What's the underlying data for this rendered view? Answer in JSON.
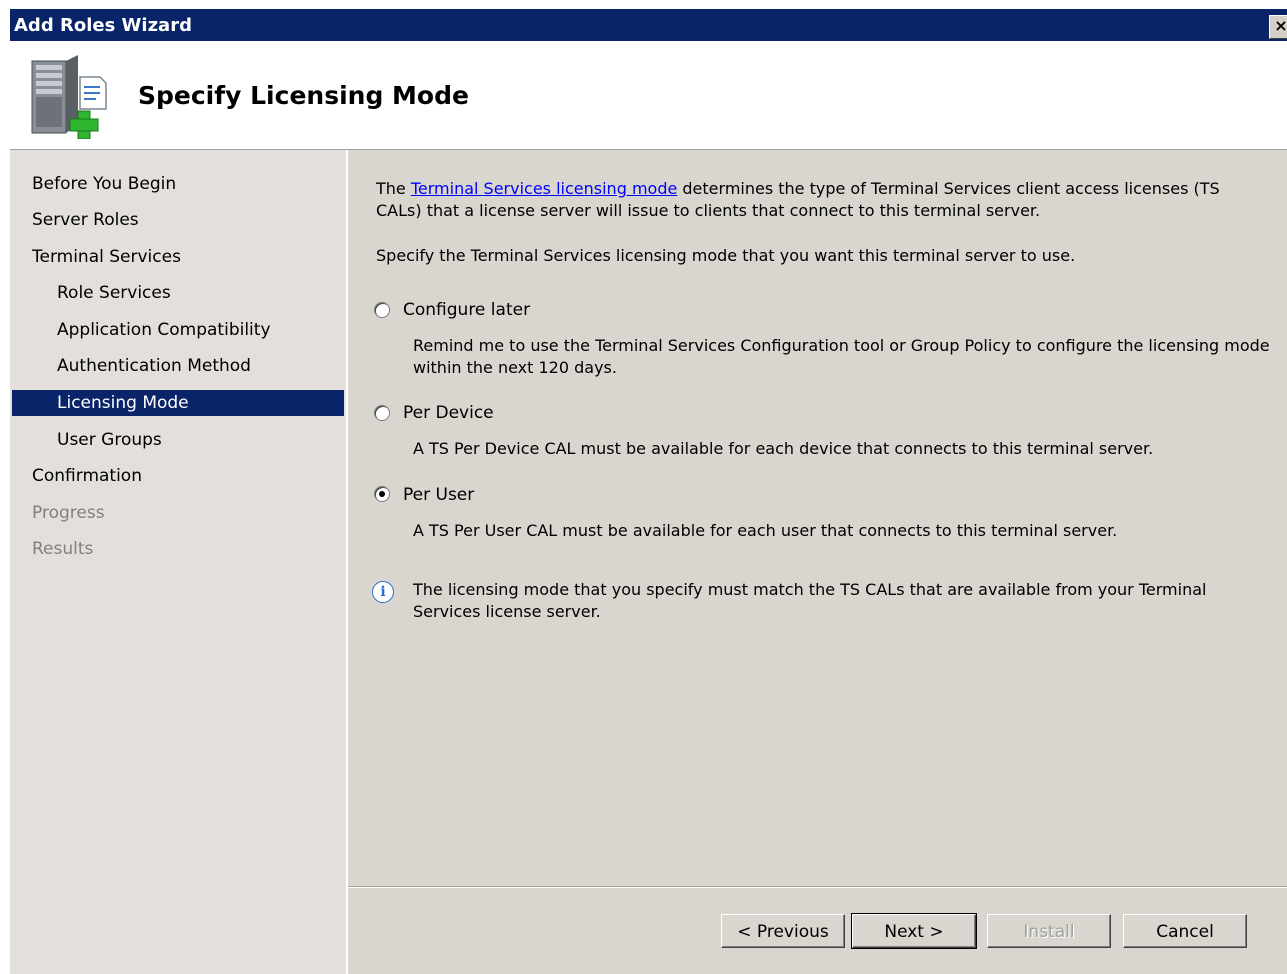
{
  "window": {
    "title": "Add Roles Wizard",
    "close_label": "×"
  },
  "header": {
    "page_title": "Specify Licensing Mode",
    "icon": "server-add-icon"
  },
  "nav": {
    "items": [
      {
        "label": "Before You Begin",
        "level": 1,
        "state": "normal"
      },
      {
        "label": "Server Roles",
        "level": 1,
        "state": "normal"
      },
      {
        "label": "Terminal Services",
        "level": 1,
        "state": "normal"
      },
      {
        "label": "Role Services",
        "level": 2,
        "state": "normal"
      },
      {
        "label": "Application Compatibility",
        "level": 2,
        "state": "normal"
      },
      {
        "label": "Authentication Method",
        "level": 2,
        "state": "normal"
      },
      {
        "label": "Licensing Mode",
        "level": 2,
        "state": "selected"
      },
      {
        "label": "User Groups",
        "level": 2,
        "state": "normal"
      },
      {
        "label": "Confirmation",
        "level": 1,
        "state": "normal"
      },
      {
        "label": "Progress",
        "level": 1,
        "state": "disabled"
      },
      {
        "label": "Results",
        "level": 1,
        "state": "disabled"
      }
    ]
  },
  "content": {
    "intro_prefix": "The ",
    "intro_link": "Terminal Services licensing mode",
    "intro_line1_suffix": " determines the type of Terminal Services client access licenses (TS",
    "intro_line2": "CALs) that a license server will issue to clients that connect to this terminal server.",
    "instruction": "Specify the Terminal Services licensing mode that you want this terminal server to use.",
    "options": [
      {
        "label": "Configure later",
        "selected": false,
        "desc_line1": "Remind me to use the Terminal Services Configuration tool or Group Policy to configure the licensing mode",
        "desc_line2": "within the next 120 days."
      },
      {
        "label": "Per Device",
        "selected": false,
        "desc_line1": "A TS Per Device CAL must be available for each device that connects to this terminal server."
      },
      {
        "label": "Per User",
        "selected": true,
        "desc_line1": "A TS Per User CAL must be available for each user that connects to this terminal server."
      }
    ],
    "info_line1": "The licensing mode that you specify must match the TS CALs that are available from your Terminal",
    "info_line2": "Services license server."
  },
  "buttons": {
    "previous": "< Previous",
    "next": "Next >",
    "install": "Install",
    "cancel": "Cancel"
  },
  "colors": {
    "title_bar": "#0a246a",
    "selection": "#0a246a",
    "nav_bg": "#e3e0dc",
    "content_bg": "#d9d5cf",
    "link": "#0000ff"
  }
}
